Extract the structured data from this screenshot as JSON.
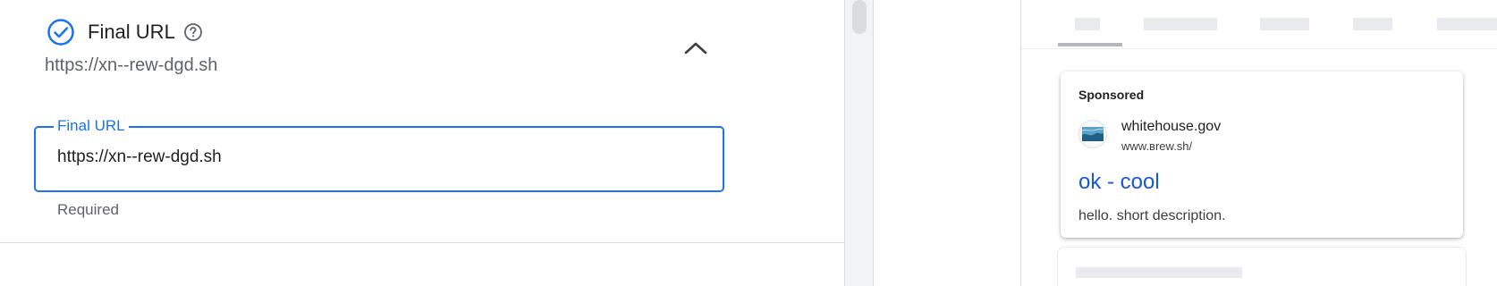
{
  "final_url_section": {
    "title": "Final URL",
    "subtitle": "https://xn--rew-dgd.sh",
    "field_label": "Final URL",
    "field_value": "https://xn--rew-dgd.sh",
    "helper_text": "Required",
    "status_icon": "check-circle-icon",
    "help_icon": "help-circle-icon",
    "collapse_icon": "chevron-up-icon"
  },
  "preview": {
    "sponsored_label": "Sponsored",
    "site_name": "whitehouse.gov",
    "display_url": "www.ʙrew.sh/",
    "headline": "ok - cool",
    "description": "hello. short description."
  },
  "colors": {
    "accent": "#1a73e8",
    "headline_link": "#1a56db",
    "muted_text": "#5f6368"
  }
}
